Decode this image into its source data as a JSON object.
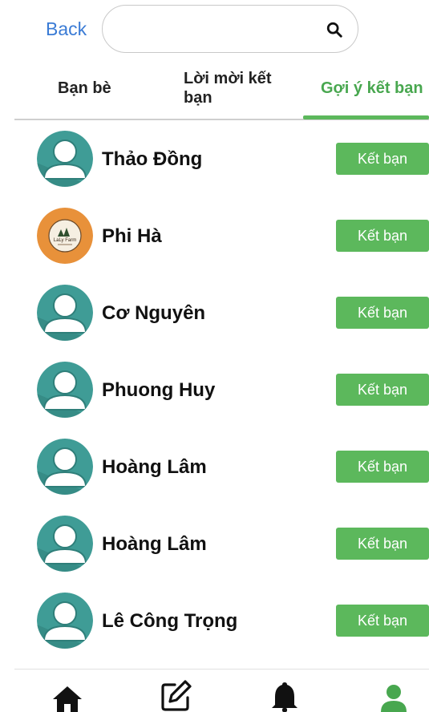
{
  "header": {
    "back_label": "Back",
    "search_placeholder": "",
    "search_icon": "search-icon"
  },
  "tabs": [
    {
      "label": "Bạn bè",
      "active": false
    },
    {
      "label": "Lời mời kết bạn",
      "active": false
    },
    {
      "label": "Gợi ý kết bạn",
      "active": true
    }
  ],
  "colors": {
    "accent": "#5cb85c",
    "active_tab_text": "#48a74f",
    "link": "#3a7bd5",
    "avatar_bg": "#3f9c96",
    "logo_bg": "#e8913a"
  },
  "suggestions": [
    {
      "name": "Thảo Đồng",
      "avatar": "default",
      "button": "Kết bạn"
    },
    {
      "name": "Phi Hà",
      "avatar": "logo",
      "logo_text": "LaLy Farm",
      "button": "Kết bạn"
    },
    {
      "name": "Cơ Nguyên",
      "avatar": "default",
      "button": "Kết bạn"
    },
    {
      "name": "Phuong Huy",
      "avatar": "default",
      "button": "Kết bạn"
    },
    {
      "name": "Hoàng Lâm",
      "avatar": "default",
      "button": "Kết bạn"
    },
    {
      "name": "Hoàng Lâm",
      "avatar": "default",
      "button": "Kết bạn"
    },
    {
      "name": "Lê Công Trọng",
      "avatar": "default",
      "button": "Kết bạn"
    }
  ],
  "bottom_nav": [
    {
      "icon": "home-icon",
      "active": false
    },
    {
      "icon": "edit-icon",
      "active": false
    },
    {
      "icon": "bell-icon",
      "active": false
    },
    {
      "icon": "user-icon",
      "active": true
    }
  ]
}
